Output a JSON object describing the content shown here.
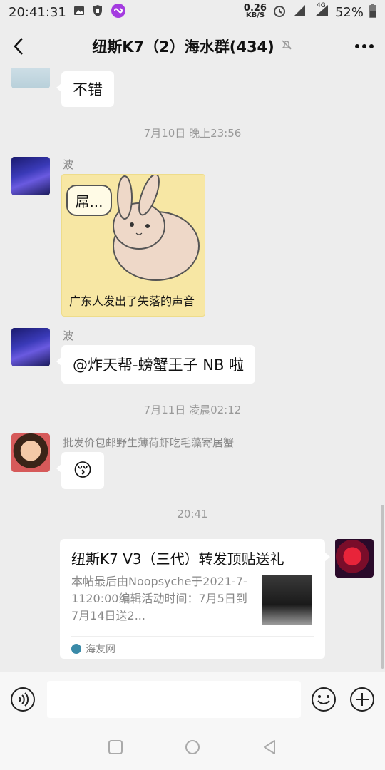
{
  "status_bar": {
    "time": "20:41:31",
    "net_speed_value": "0.26",
    "net_speed_unit": "KB/S",
    "network_type": "4G",
    "battery": "52%"
  },
  "header": {
    "title": "纽斯K7（2）海水群(434)",
    "muted": true
  },
  "messages": {
    "m1": {
      "text": "不错"
    },
    "ts1": "7月10日 晚上23:56",
    "m2": {
      "sender": "波",
      "sticker_speech": "屌...",
      "sticker_caption": "广东人发出了失落的声音"
    },
    "m3": {
      "sender": "波",
      "text": "@炸天帮-螃蟹王子  NB 啦"
    },
    "ts2": "7月11日 凌晨02:12",
    "m4": {
      "sender": "批发价包邮野生薄荷虾吃毛藻寄居蟹",
      "emoji": "😚"
    },
    "ts3": "20:41",
    "m5": {
      "title": "纽斯K7 V3（三代）转发顶贴送礼",
      "description": "本帖最后由Noopsyche于2021-7-1120:00编辑活动时间：7月5日到7月14日送2...",
      "source": "海友网"
    }
  },
  "colors": {
    "background": "#ededed",
    "bubble": "#ffffff",
    "accent": "#111111"
  }
}
